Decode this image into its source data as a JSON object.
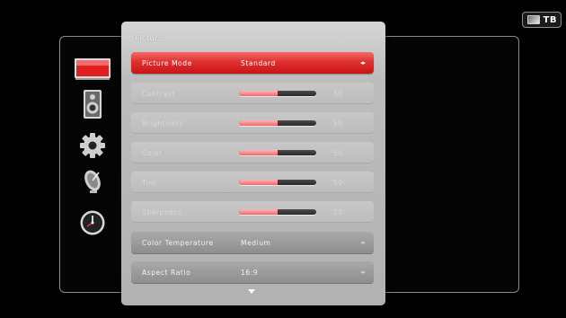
{
  "source": {
    "label": "TB",
    "icon": "tv-input-icon"
  },
  "categories": [
    {
      "name": "picture",
      "icon": "tv-picture-icon",
      "selected": true
    },
    {
      "name": "sound",
      "icon": "speaker-icon",
      "selected": false
    },
    {
      "name": "setup",
      "icon": "gear-icon",
      "selected": false
    },
    {
      "name": "channel",
      "icon": "satellite-dish-icon",
      "selected": false
    },
    {
      "name": "time",
      "icon": "clock-icon",
      "selected": false
    }
  ],
  "menu": {
    "title": "Picture",
    "items": [
      {
        "label": "Picture Mode",
        "value": "Standard",
        "state": "active",
        "arrows": "◂▸"
      },
      {
        "label": "Contrast",
        "level": 50,
        "number": "50",
        "state": "disabled"
      },
      {
        "label": "Brightness",
        "level": 50,
        "number": "50",
        "state": "disabled"
      },
      {
        "label": "Color",
        "level": 50,
        "number": "50",
        "state": "disabled"
      },
      {
        "label": "Tint",
        "level": 50,
        "number": "50",
        "state": "disabled"
      },
      {
        "label": "Sharpness",
        "level": 50,
        "number": "50",
        "state": "disabled"
      },
      {
        "label": "Color Temperature",
        "value": "Medium",
        "state": "normal",
        "arrows": "◂▸"
      },
      {
        "label": "Aspect Ratio",
        "value": "16:9",
        "state": "normal",
        "arrows": "◂▸"
      }
    ],
    "more_indicator": "down-arrow-icon"
  },
  "colors": {
    "accent": "#e03030",
    "bar_fill": "#ee6a6a",
    "panel": "#bdbdbd"
  }
}
